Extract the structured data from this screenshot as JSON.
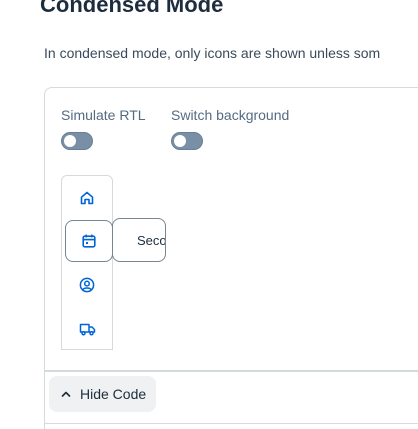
{
  "section": {
    "title": "Condensed Mode",
    "description": "In condensed mode, only icons are shown unless som"
  },
  "controls": {
    "rtl_label": "Simulate RTL",
    "background_label": "Switch background"
  },
  "nav": {
    "items": [
      {
        "icon": "home-icon"
      },
      {
        "icon": "calendar-icon"
      },
      {
        "icon": "user-icon"
      },
      {
        "icon": "truck-icon"
      }
    ],
    "popover_text": "Seco"
  },
  "code_button": {
    "label": "Hide Code"
  },
  "colors": {
    "accent": "#0064d9",
    "toggle_off": "#788fa6"
  }
}
